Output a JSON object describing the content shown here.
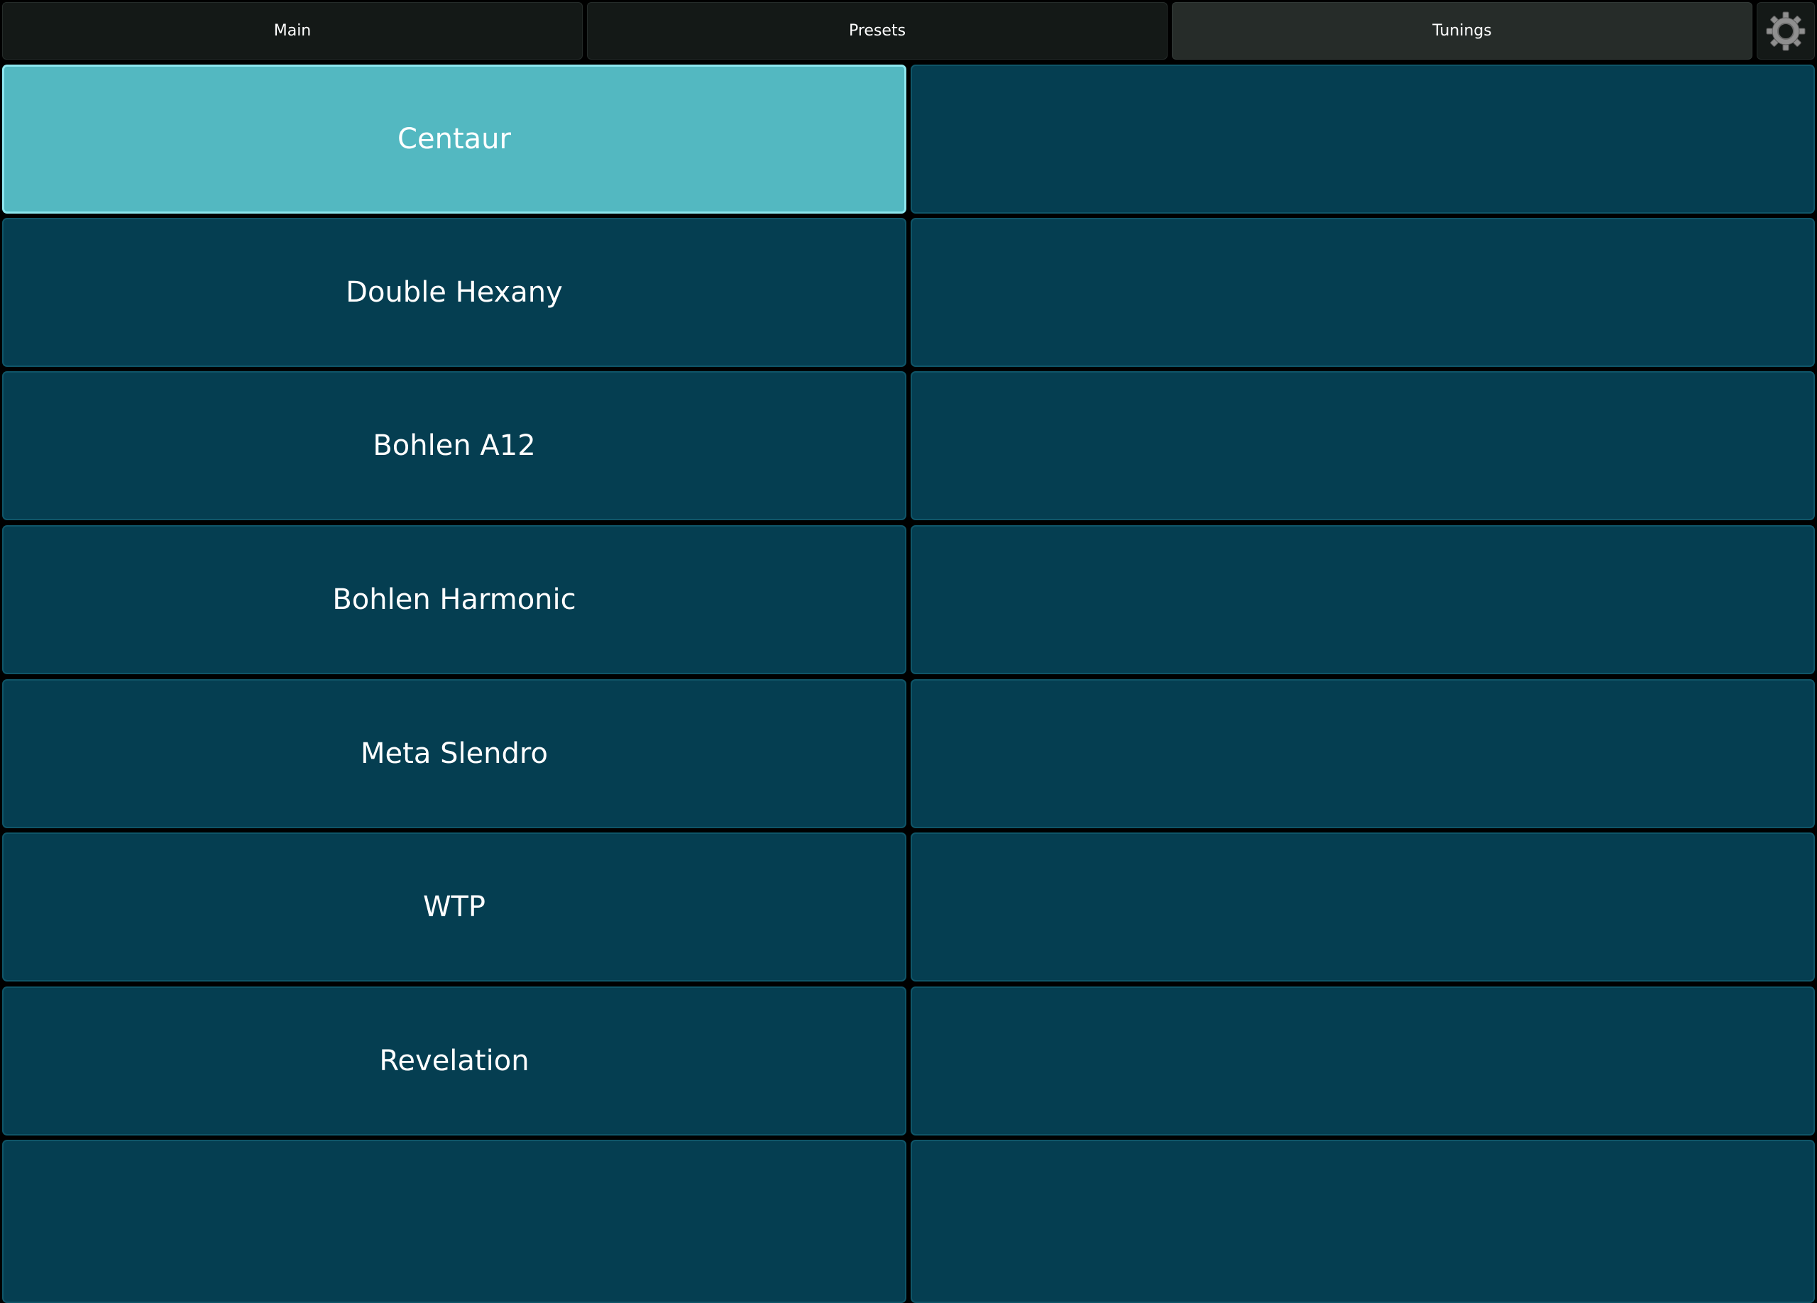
{
  "tabs": [
    {
      "label": "Main"
    },
    {
      "label": "Presets"
    },
    {
      "label": "Tunings",
      "active": true
    }
  ],
  "settings": {
    "icon": "gear-icon"
  },
  "tunings": {
    "selected_index": 0,
    "items": [
      "Centaur",
      "Double Hexany",
      "Bohlen A12",
      "Bohlen Harmonic",
      "Meta Slendro",
      "WTP",
      "Revelation",
      ""
    ]
  },
  "colors": {
    "tab_bg": "#141917",
    "tab_active_bg": "#262c29",
    "cell_bg": "#053e51",
    "cell_border": "#0f5568",
    "selected_bg": "#53b8c1",
    "selected_border": "#8de6ee",
    "text": "#ffffff"
  }
}
